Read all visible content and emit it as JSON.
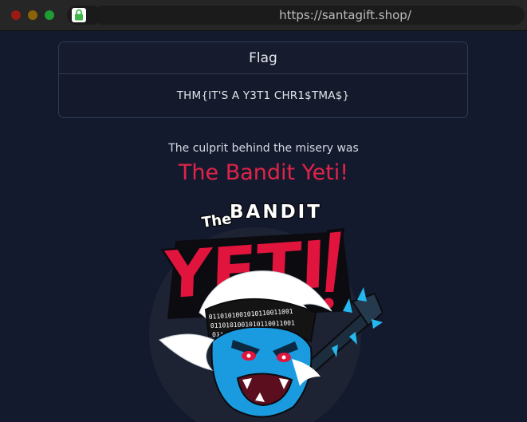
{
  "browser": {
    "url": "https://santagift.shop/",
    "lock_icon": "lock-icon"
  },
  "flag_card": {
    "title": "Flag",
    "value": "THM{IT'S A Y3T1 CHR1$TMA$}"
  },
  "culprit": {
    "intro": "The culprit behind the misery was",
    "name": "The Bandit Yeti!"
  },
  "logo": {
    "small_text": "The",
    "top_word": "BANDIT",
    "big_word": "YETI",
    "binary_band": "0110101001010110011001"
  },
  "colors": {
    "page_bg": "#141a2e",
    "accent_red": "#e02448",
    "yeti_blue": "#1a9be0",
    "lock_green": "#3fb54a"
  }
}
